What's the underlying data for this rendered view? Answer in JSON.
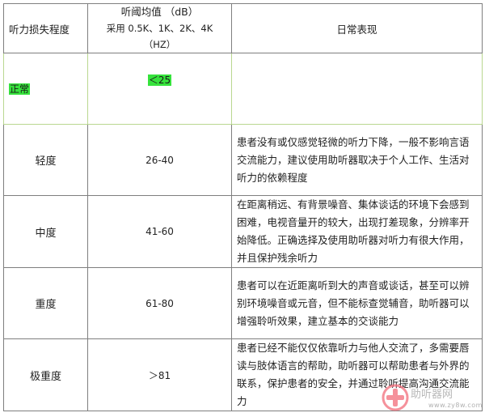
{
  "headers": {
    "degree": "听力损失程度",
    "threshold_line1": "听阈均值 （dB）",
    "threshold_line2": "采用 0.5K、1K、2K、4K（HZ）",
    "daily": "日常表现"
  },
  "rows": [
    {
      "level": "正常",
      "value": "＜25",
      "desc": "",
      "highlight_color": "#36e33c"
    },
    {
      "level": "轻度",
      "value": "26-40",
      "desc": "患者没有或仅感觉轻微的听力下降，一般不影响言语交流能力，建议使用助听器取决于个人工作、生活对听力的依赖程度"
    },
    {
      "level": "中度",
      "value": "41-60",
      "desc": "在距离稍远、有背景噪音、集体谈话的环境下会感到困难，电视音量开的较大，出现打差现象，分辨率开始降低。正确选择及使用助听器对听力有很大作用，并且保护残余听力"
    },
    {
      "level": "重度",
      "value": "61-80",
      "desc": "患者可以在近距离听到大的声音或谈话，甚至可以辨别环境噪音或元音，但不能标查觉辅音，助听器可以增强聆听效果，建立基本的交谈能力"
    },
    {
      "level": "极重度",
      "value": "＞81",
      "desc": "患者已经不能仅仅依靠听力与他人交流了，多需要唇读与肢体语言的帮助，助听器可以帮助患者与外界的联系，保护患者的安全，并通过聆听提高沟通交流能力"
    }
  ],
  "watermark": {
    "text": "助听器网",
    "url": "www.zy8w.com",
    "logo_color": "#f26d7a"
  }
}
